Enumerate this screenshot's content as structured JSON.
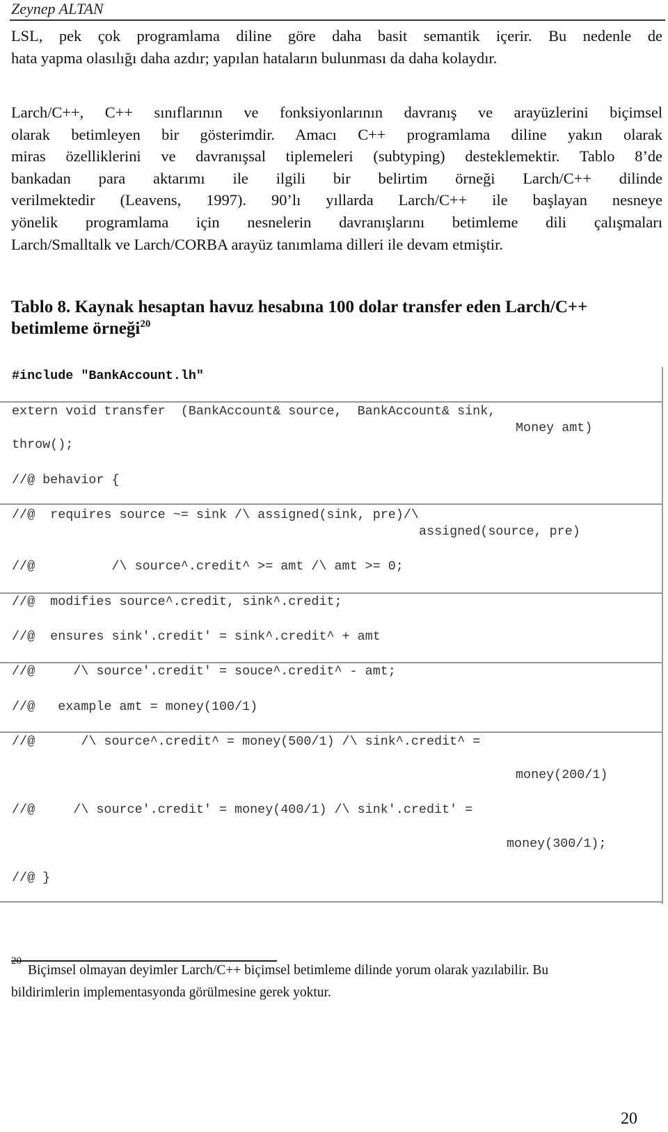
{
  "header": {
    "author": "Zeynep ALTAN"
  },
  "paragraphs": [
    {
      "lines": [
        "LSL, pek çok programlama diline göre daha basit semantik içerir. Bu nedenle de",
        "hata yapma olasılığı daha azdır; yapılan hataların bulunması da daha kolaydır."
      ]
    },
    {
      "lines": [
        "Larch/C++, C++ sınıflarının ve fonksiyonlarının davranış ve arayüzlerini biçimsel",
        "olarak betimleyen bir gösterimdir. Amacı C++ programlama diline yakın olarak",
        "miras özelliklerini ve davranışsal tiplemeleri (subtyping) desteklemektir.  Tablo 8’de",
        "bankadan para aktarımı ile ilgili bir belirtim örneği    Larch/C++ dilinde",
        "verilmektedir (Leavens, 1997). 90’lı yıllarda Larch/C++  ile başlayan nesneye",
        "yönelik programlama için nesnelerin davranışlarını betimleme dili çalışmaları",
        "Larch/Smalltalk ve Larch/CORBA arayüz tanımlama dilleri ile devam etmiştir."
      ]
    }
  ],
  "table_caption": {
    "text_line1": "Tablo 8. Kaynak hesaptan havuz hesabına 100 dolar transfer eden Larch/C++",
    "text_line2": "betimleme örneği",
    "footnote_ref": "20"
  },
  "code_lines": [
    {
      "text": "#include \"BankAccount.lh\"",
      "bold": true
    },
    {
      "text": "extern void transfer  (BankAccount& source,  BankAccount& sink,"
    },
    {
      "text": "Money amt)"
    },
    {
      "text": "throw();"
    },
    {
      "text": "//@ behavior {"
    },
    {
      "text": "//@  requires source ~= sink /\\ assigned(sink, pre)/\\"
    },
    {
      "text": "assigned(source, pre)"
    },
    {
      "text": "//@          /\\ source^.credit^ >= amt /\\ amt >= 0;"
    },
    {
      "text": "//@  modifies source^.credit, sink^.credit;"
    },
    {
      "text": "//@  ensures sink'.credit' = sink^.credit^ + amt"
    },
    {
      "text": "//@     /\\ source'.credit' = souce^.credit^ - amt;"
    },
    {
      "text": "//@   example amt = money(100/1)"
    },
    {
      "text": "//@      /\\ source^.credit^ = money(500/1) /\\ sink^.credit^ ="
    },
    {
      "text": "money(200/1)"
    },
    {
      "text": "//@     /\\ source'.credit' = money(400/1) /\\ sink'.credit' ="
    },
    {
      "text": "money(300/1);"
    },
    {
      "text": "//@ }"
    }
  ],
  "footnote": {
    "number": "20",
    "line1": "Biçimsel olmayan deyimler Larch/C++   biçimsel betimleme dilinde yorum olarak yazılabilir. Bu",
    "line2": "bildirimlerin implementasyonda görülmesine gerek yoktur."
  },
  "page_number": "20"
}
